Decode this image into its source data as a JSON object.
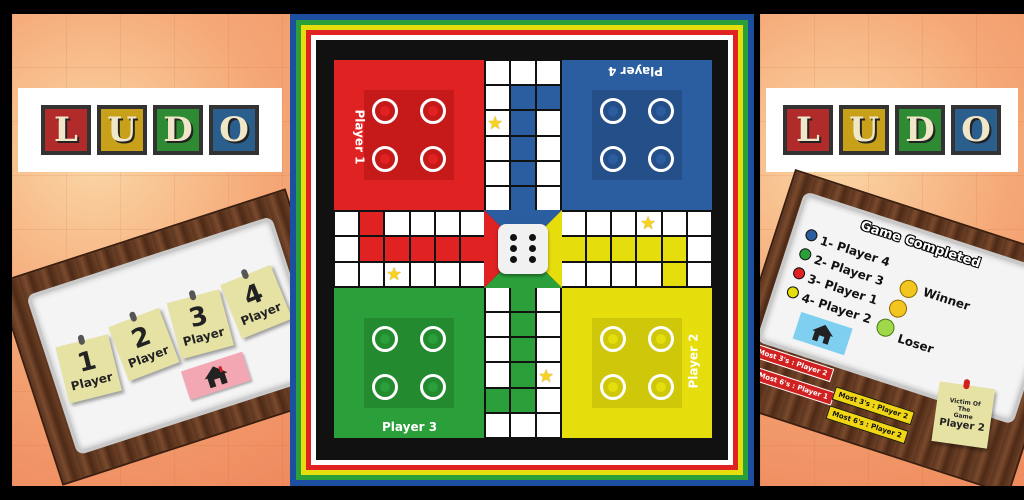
{
  "logo": {
    "letters": [
      "L",
      "U",
      "D",
      "O"
    ],
    "colors": [
      "#b22b2b",
      "#c9a01a",
      "#2f8a34",
      "#2a5e8c"
    ]
  },
  "menu": {
    "options": [
      {
        "num": "1",
        "label": "Player"
      },
      {
        "num": "2",
        "label": "Player"
      },
      {
        "num": "3",
        "label": "Player"
      },
      {
        "num": "4",
        "label": "Player"
      }
    ],
    "home_icon": "house-icon"
  },
  "board": {
    "players": {
      "red": {
        "label": "Player 1",
        "color": "#e02222"
      },
      "blue": {
        "label": "Player 4",
        "color": "#2a5ea0"
      },
      "green": {
        "label": "Player 3",
        "color": "#2ba03a"
      },
      "yellow": {
        "label": "Player 2",
        "color": "#e5dd0c"
      }
    },
    "dice_value": 6
  },
  "results": {
    "title": "Game Completed",
    "rows": [
      {
        "rank": "1-",
        "name": "Player 4",
        "color": "#2a5ea0",
        "note": "Winner"
      },
      {
        "rank": "2-",
        "name": "Player 3",
        "color": "#2ba03a",
        "note": ""
      },
      {
        "rank": "3-",
        "name": "Player 1",
        "color": "#e02222",
        "note": ""
      },
      {
        "rank": "4-",
        "name": "Player 2",
        "color": "#e5dd0c",
        "note": "Loser"
      }
    ],
    "victim_note": {
      "line1": "Victim Of",
      "line2": "The",
      "line3": "Game",
      "player": "Player 2"
    },
    "stats": {
      "most_sixes_red_a": "Most 3's : Player 2",
      "most_sixes_red_b": "Most 6's : Player 1",
      "most_yel_a": "Most 3's : Player 2",
      "most_yel_b": "Most 6's : Player 2"
    }
  }
}
